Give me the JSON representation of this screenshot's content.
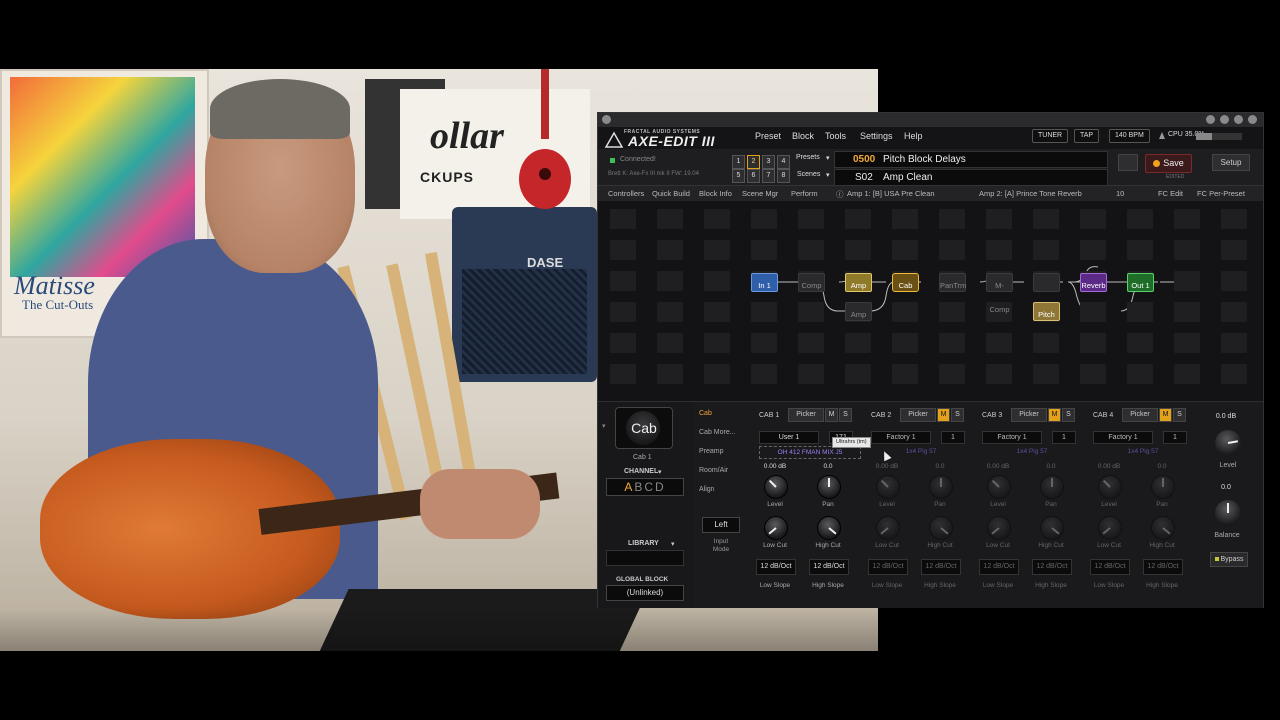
{
  "app": {
    "logo_small": "FRACTAL AUDIO SYSTEMS",
    "logo_big": "AXE-EDIT III",
    "menu": [
      "Preset",
      "Block",
      "Tools",
      "Settings",
      "Help"
    ],
    "tuner": "TUNER",
    "tap": "TAP",
    "bpm": "140 BPM",
    "cpu": "CPU 35.0%",
    "cpu_fraction": 0.35,
    "connected": "Connected!",
    "device": "Brett K: Axe-Fx III mk II FW: 19.04",
    "scene_numbers": [
      "1",
      "2",
      "3",
      "4",
      "5",
      "6",
      "7",
      "8"
    ],
    "selected_scene": "2",
    "presets_label": "Presets",
    "scenes_label": "Scenes",
    "preset_number": "0500",
    "preset_name": "Pitch Block Delays",
    "scene_number": "S02",
    "scene_name": "Amp Clean",
    "save": "Save",
    "edited": "EDITED",
    "setup": "Setup",
    "tabs": [
      "Controllers",
      "Quick Build",
      "Block Info",
      "Scene Mgr",
      "Perform"
    ],
    "amp1": "Amp 1: [B] USA Pre Clean",
    "amp2": "Amp 2: [A] Prince Tone Reverb",
    "tempo_num": "10",
    "fc_edit": "FC Edit",
    "fc_per_preset": "FC Per-Preset"
  },
  "grid_blocks": {
    "in1": "In 1",
    "comp": "Comp",
    "amp": "Amp",
    "amp2": "Amp",
    "cab": "Cab",
    "pantrm": "PanTrm",
    "mcomp": "M-Comp",
    "pitch": "Pitch",
    "reverb": "Reverb",
    "out1": "Out 1"
  },
  "editor": {
    "block_name": "Cab",
    "block_instance": "Cab 1",
    "channel_label": "CHANNEL",
    "channels": "ABCD",
    "selected_channel": "A",
    "library": "LIBRARY",
    "global_block": "GLOBAL BLOCK",
    "unlinked": "(Unlinked)",
    "nav": [
      "Cab",
      "Cab More...",
      "Preamp",
      "Room/Air",
      "Align"
    ],
    "input_mode_value": "Left",
    "input_mode_label": "Input Mode",
    "tooltip": "Ultrahrs (tm)",
    "main_level_value": "0.0 dB",
    "main_level_label": "Level",
    "balance_value": "0.0",
    "balance_label": "Balance",
    "bypass": "Bypass",
    "cabs": [
      {
        "head": "CAB 1",
        "picker": "Picker",
        "m": "M",
        "s": "S",
        "bank": "User 1",
        "index": "171",
        "ir": "OH 412 FMAN MIX J5",
        "level": "0.00 dB",
        "pan": "0.0",
        "level_label": "Level",
        "pan_label": "Pan",
        "lowcut_label": "Low Cut",
        "highcut_label": "High Cut",
        "low_slope": "12 dB/Oct",
        "high_slope": "12 dB/Oct",
        "low_slope_label": "Low Slope",
        "high_slope_label": "High Slope"
      },
      {
        "head": "CAB 2",
        "picker": "Picker",
        "m": "M",
        "s": "S",
        "bank": "Factory 1",
        "index": "1",
        "ir": "1x4 Pig 57",
        "level": "0.00 dB",
        "pan": "0.0",
        "level_label": "Level",
        "pan_label": "Pan",
        "lowcut_label": "Low Cut",
        "highcut_label": "High Cut",
        "low_slope": "12 dB/Oct",
        "high_slope": "12 dB/Oct",
        "low_slope_label": "Low Slope",
        "high_slope_label": "High Slope"
      },
      {
        "head": "CAB 3",
        "picker": "Picker",
        "m": "M",
        "s": "S",
        "bank": "Factory 1",
        "index": "1",
        "ir": "1x4 Pig 57",
        "level": "0.00 dB",
        "pan": "0.0",
        "level_label": "Level",
        "pan_label": "Pan",
        "lowcut_label": "Low Cut",
        "highcut_label": "High Cut",
        "low_slope": "12 dB/Oct",
        "high_slope": "12 dB/Oct",
        "low_slope_label": "Low Slope",
        "high_slope_label": "High Slope"
      },
      {
        "head": "CAB 4",
        "picker": "Picker",
        "m": "M",
        "s": "S",
        "bank": "Factory 1",
        "index": "1",
        "ir": "1x4 Pig 57",
        "level": "0.00 dB",
        "pan": "0.0",
        "level_label": "Level",
        "pan_label": "Pan",
        "lowcut_label": "Low Cut",
        "highcut_label": "High Cut",
        "low_slope": "12 dB/Oct",
        "high_slope": "12 dB/Oct",
        "low_slope_label": "Low Slope",
        "high_slope_label": "High Slope"
      }
    ]
  },
  "webcam": {
    "poster_title": "Matisse",
    "poster_sub": "The Cut-Outs",
    "poster_brand": "ollar",
    "poster_brand_sub": "CKUPS",
    "amp_brand": "DASE"
  },
  "colors": {
    "accent": "#f2a83a",
    "in_block": "#2f5fa8",
    "amp_block": "#b8a24a",
    "cab_block": "#c29a2a",
    "pitch_block": "#b79b4c",
    "reverb_block": "#7a3aa8",
    "out_block": "#2a9a3a"
  }
}
